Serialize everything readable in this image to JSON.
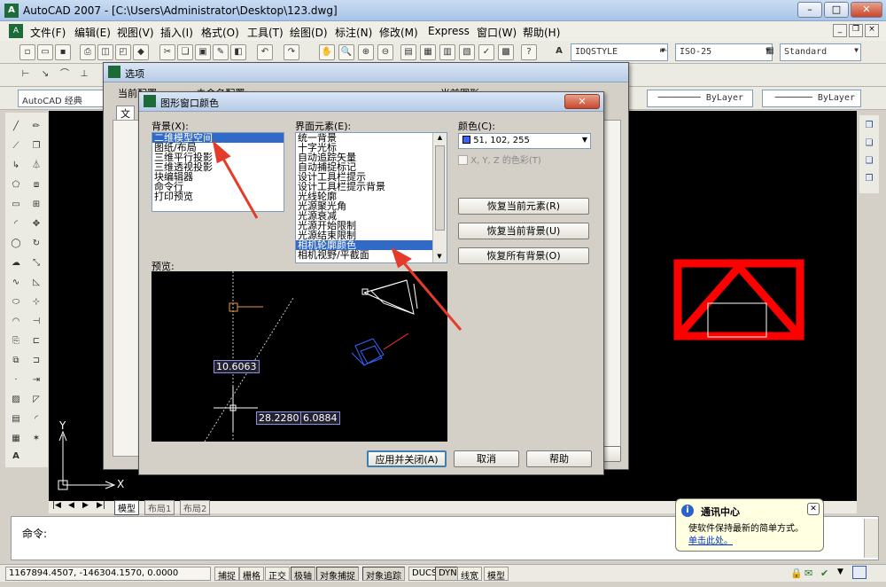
{
  "window": {
    "title": "AutoCAD 2007 - [C:\\Users\\Administrator\\Desktop\\123.dwg]"
  },
  "menu": [
    "文件(F)",
    "编辑(E)",
    "视图(V)",
    "插入(I)",
    "格式(O)",
    "工具(T)",
    "绘图(D)",
    "标注(N)",
    "修改(M)",
    "Express",
    "窗口(W)",
    "帮助(H)"
  ],
  "styles": {
    "text_style": "IDQSTYLE",
    "dim_style": "ISO-25",
    "table_style": "Standard"
  },
  "workspace": "AutoCAD 经典",
  "layers": {
    "linetype": "ByLayer",
    "lineweight": "ByLayer"
  },
  "options_dialog": {
    "title": "选项",
    "current_profile": "当前配置",
    "current_profile_value": "<<未命名配置>>",
    "current_drawing": "当前图形",
    "tab": "文"
  },
  "color_dialog": {
    "title": "图形窗口颜色",
    "context_label": "背景(X):",
    "contexts": [
      "二维模型空间",
      "图纸/布局",
      "三维平行投影",
      "三维透视投影",
      "块编辑器",
      "命令行",
      "打印预览"
    ],
    "selected_context": 0,
    "element_label": "界面元素(E):",
    "elements": [
      "统一背景",
      "十字光标",
      "自动追踪矢量",
      "自动捕捉标记",
      "设计工具栏提示",
      "设计工具栏提示背景",
      "光线轮廓",
      "光源聚光角",
      "光源衰减",
      "光源开始限制",
      "光源结束限制",
      "相机轮廓颜色",
      "相机视野/平截面"
    ],
    "selected_element": 11,
    "color_label": "颜色(C):",
    "color_value": "51, 102, 255",
    "xyz_label": "X, Y, Z 的色彩(T)",
    "restore_element": "恢复当前元素(R)",
    "restore_background": "恢复当前背景(U)",
    "restore_all": "恢复所有背景(O)",
    "preview_label": "预览:",
    "dim1": "10.6063",
    "dim2": "28.2280",
    "dim3": "6.0884",
    "apply": "应用并关闭(A)",
    "cancel": "取消",
    "help": "帮助"
  },
  "axis": {
    "y": "Y",
    "x": "X"
  },
  "layout_tabs": [
    "模型",
    "布局1",
    "布局2"
  ],
  "command": {
    "label": "命令:"
  },
  "coords": "1167894.4507, -146304.1570, 0.0000",
  "status_buttons": [
    "捕捉",
    "栅格",
    "正交",
    "极轴",
    "对象捕捉",
    "对象追踪",
    "DUCS",
    "DYN",
    "线宽",
    "模型"
  ],
  "balloon": {
    "title": "通讯中心",
    "text": "使软件保持最新的简单方式。",
    "link": "单击此处。"
  },
  "colors": {
    "accent": "#3366ff",
    "red_shape": "#ff0000"
  }
}
